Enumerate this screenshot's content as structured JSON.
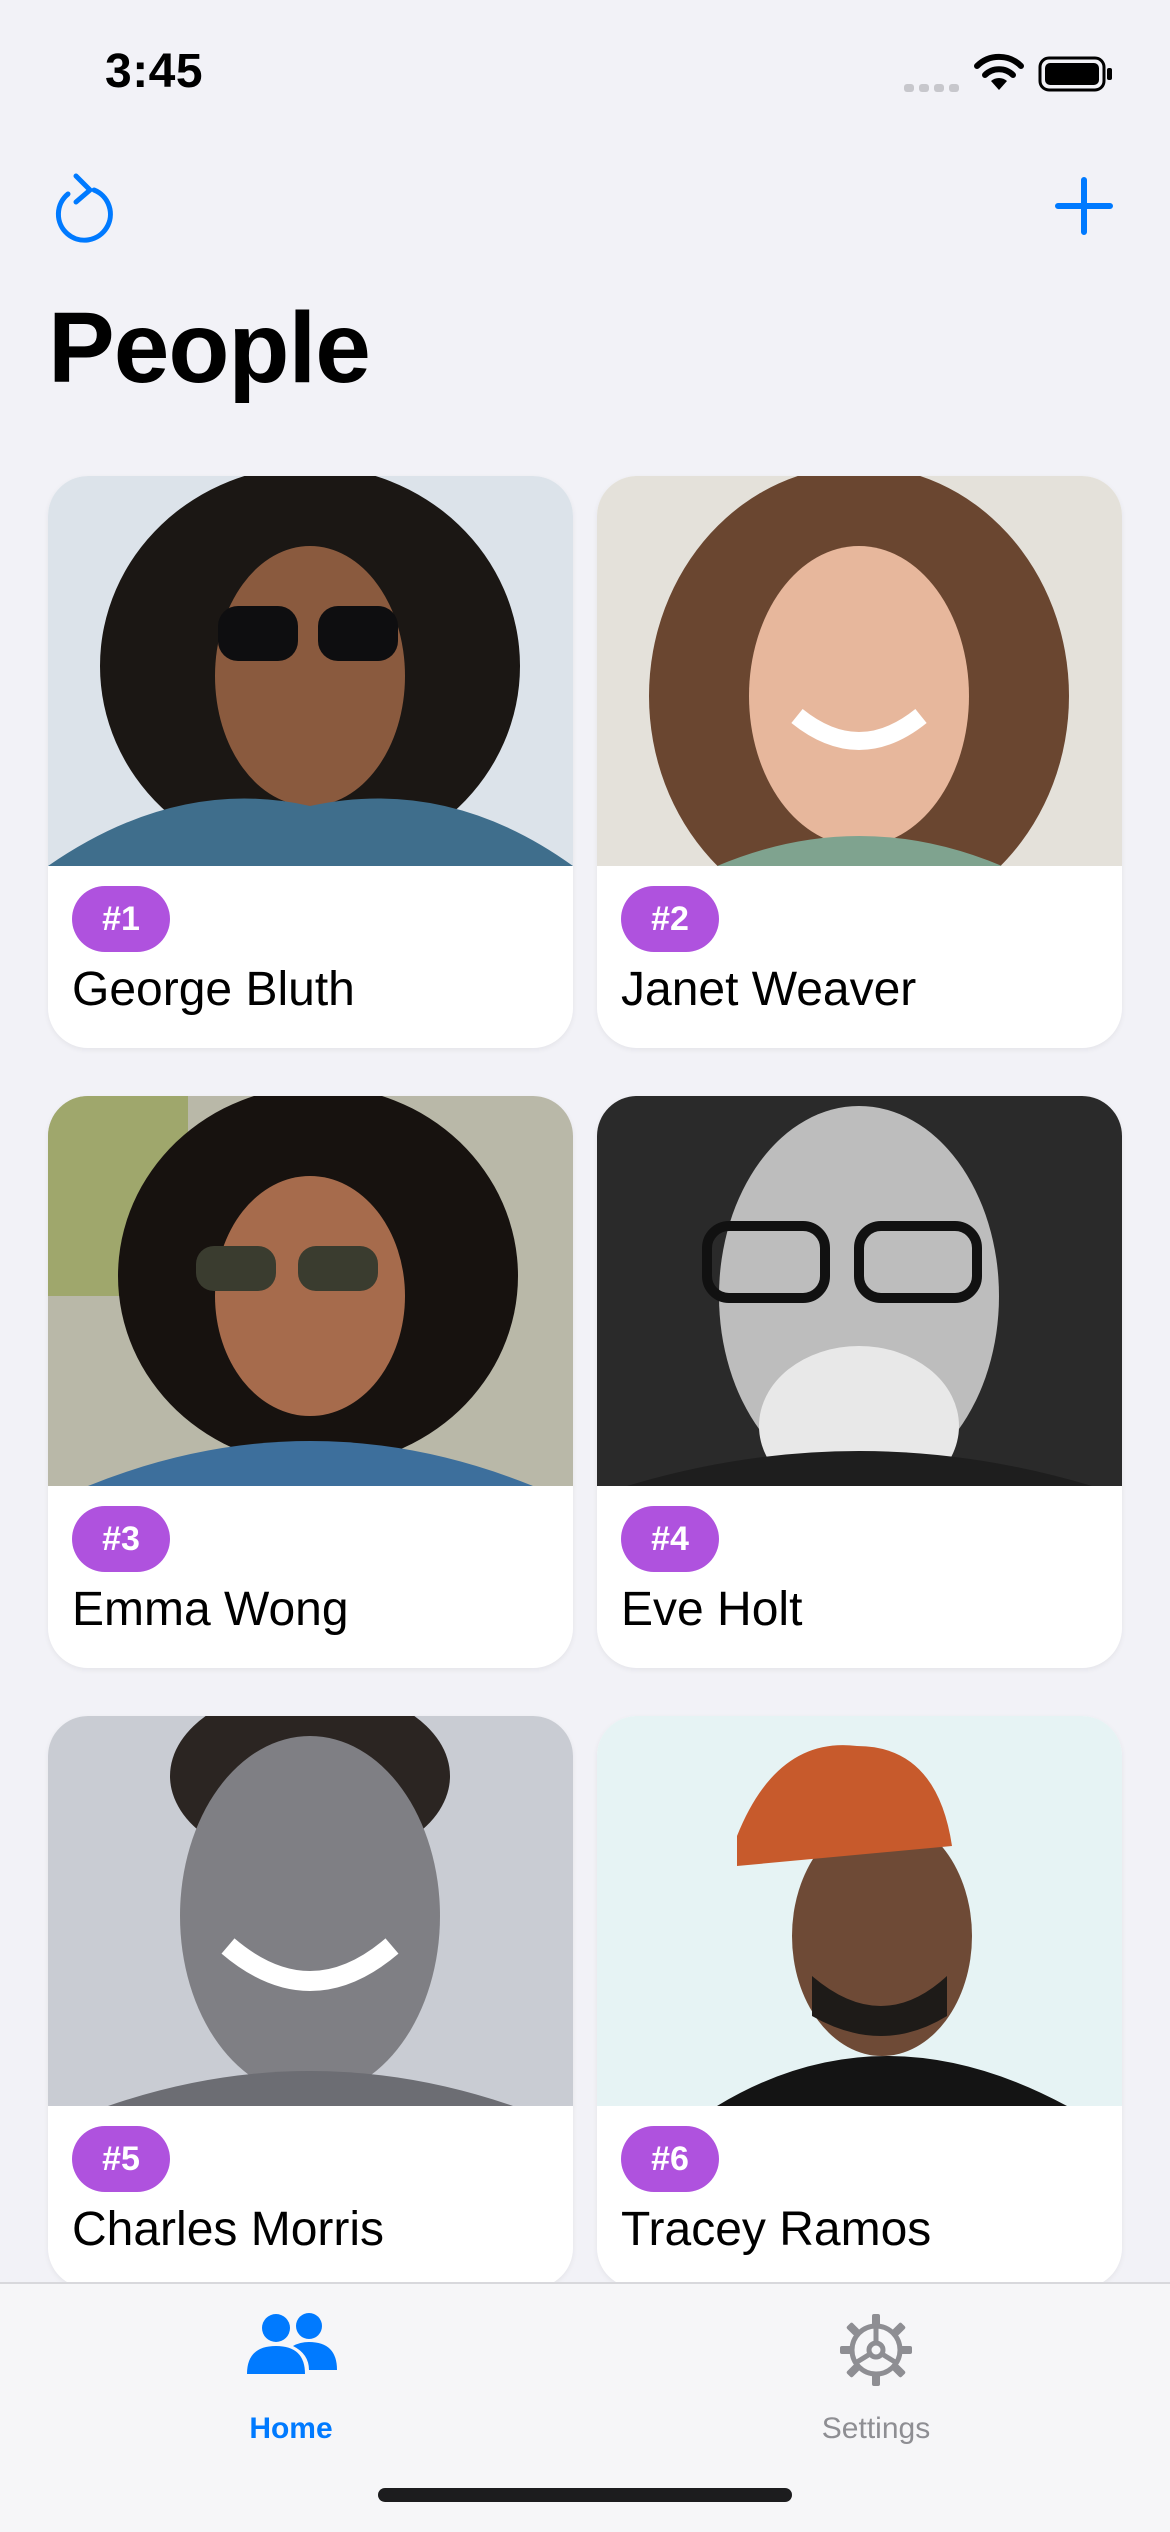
{
  "status_bar": {
    "time": "3:45",
    "icons": [
      "cellular-signal-icon",
      "wifi-icon",
      "battery-icon"
    ]
  },
  "nav": {
    "title": "People",
    "left_icon": "refresh-icon",
    "right_icon": "plus-icon",
    "accent_color": "#007AFF"
  },
  "people": [
    {
      "badge": "#1",
      "name": "George Bluth"
    },
    {
      "badge": "#2",
      "name": "Janet Weaver"
    },
    {
      "badge": "#3",
      "name": "Emma Wong"
    },
    {
      "badge": "#4",
      "name": "Eve Holt"
    },
    {
      "badge": "#5",
      "name": "Charles Morris"
    },
    {
      "badge": "#6",
      "name": "Tracey Ramos"
    }
  ],
  "badge_color": "#AF52DE",
  "tab_bar": {
    "tabs": [
      {
        "label": "Home",
        "icon": "people-icon",
        "selected": true
      },
      {
        "label": "Settings",
        "icon": "gear-icon",
        "selected": false
      }
    ]
  }
}
